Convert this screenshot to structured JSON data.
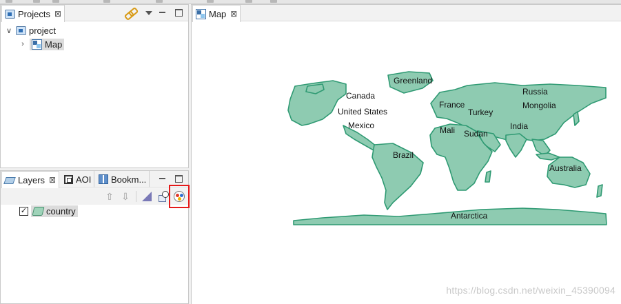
{
  "projects_panel": {
    "tab_label": "Projects",
    "tree": [
      {
        "label": "project",
        "expanded": true,
        "icon": "project-icon"
      },
      {
        "label": "Map",
        "icon": "map-icon",
        "selected": true
      }
    ]
  },
  "map_panel": {
    "tab_label": "Map",
    "countries": [
      {
        "name": "Greenland"
      },
      {
        "name": "Canada"
      },
      {
        "name": "Russia"
      },
      {
        "name": "France"
      },
      {
        "name": "Mongolia"
      },
      {
        "name": "Turkey"
      },
      {
        "name": "United States"
      },
      {
        "name": "Mexico"
      },
      {
        "name": "India"
      },
      {
        "name": "Mali"
      },
      {
        "name": "Sudan"
      },
      {
        "name": "Brazil"
      },
      {
        "name": "Australia"
      },
      {
        "name": "Antarctica"
      }
    ],
    "fill_color": "#8ecbb1",
    "stroke_color": "#2f9a73"
  },
  "layers_panel": {
    "tabs": [
      {
        "label": "Layers",
        "closable": true
      },
      {
        "label": "AOI"
      },
      {
        "label": "Bookm..."
      }
    ],
    "toolbar_icons": [
      "move-up-icon",
      "move-down-icon",
      "ruler-icon",
      "select-features-icon",
      "style-icon"
    ],
    "highlighted_tool": "style-icon",
    "layers": [
      {
        "label": "country",
        "checked": true
      }
    ]
  },
  "close_glyph": "⊠",
  "expanded_glyph": "∨",
  "collapsed_glyph": "›",
  "check_glyph": "✓",
  "up_arrow_glyph": "⇧",
  "down_arrow_glyph": "⇩",
  "accent_highlight": "#e51919",
  "watermark": "https://blog.csdn.net/weixin_45390094"
}
